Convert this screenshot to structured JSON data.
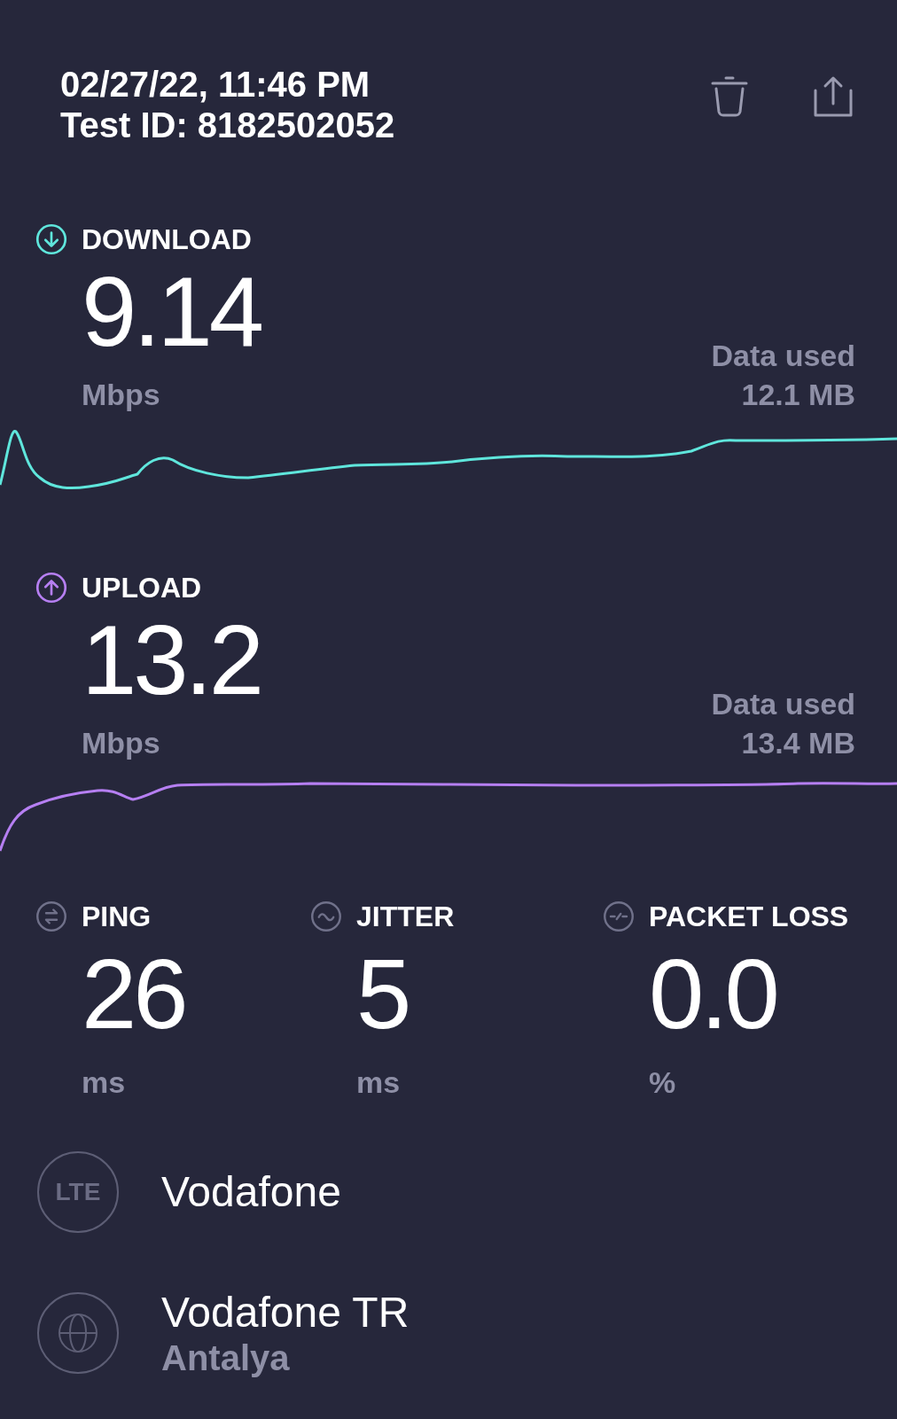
{
  "header": {
    "date": "02/27/22, 11:46 PM",
    "test_id": "Test ID: 8182502052"
  },
  "results": [
    {
      "kind": "download",
      "label": "DOWNLOAD",
      "value": "9.14",
      "unit": "Mbps",
      "data_label": "Data used",
      "data_value": "12.1 MB",
      "color": "#5fe6dc"
    },
    {
      "kind": "upload",
      "label": "UPLOAD",
      "value": "13.2",
      "unit": "Mbps",
      "data_label": "Data used",
      "data_value": "13.4 MB",
      "color": "#b67ff2"
    }
  ],
  "stats": [
    {
      "kind": "ping",
      "label": "PING",
      "value": "26",
      "unit": "ms"
    },
    {
      "kind": "jitter",
      "label": "JITTER",
      "value": "5",
      "unit": "ms"
    },
    {
      "kind": "packet_loss",
      "label": "PACKET LOSS",
      "value": "0.0",
      "unit": "%"
    }
  ],
  "providers": [
    {
      "kind": "network",
      "badge": "LTE",
      "name": "Vodafone"
    },
    {
      "kind": "server",
      "name": "Vodafone TR",
      "location": "Antalya"
    }
  ]
}
